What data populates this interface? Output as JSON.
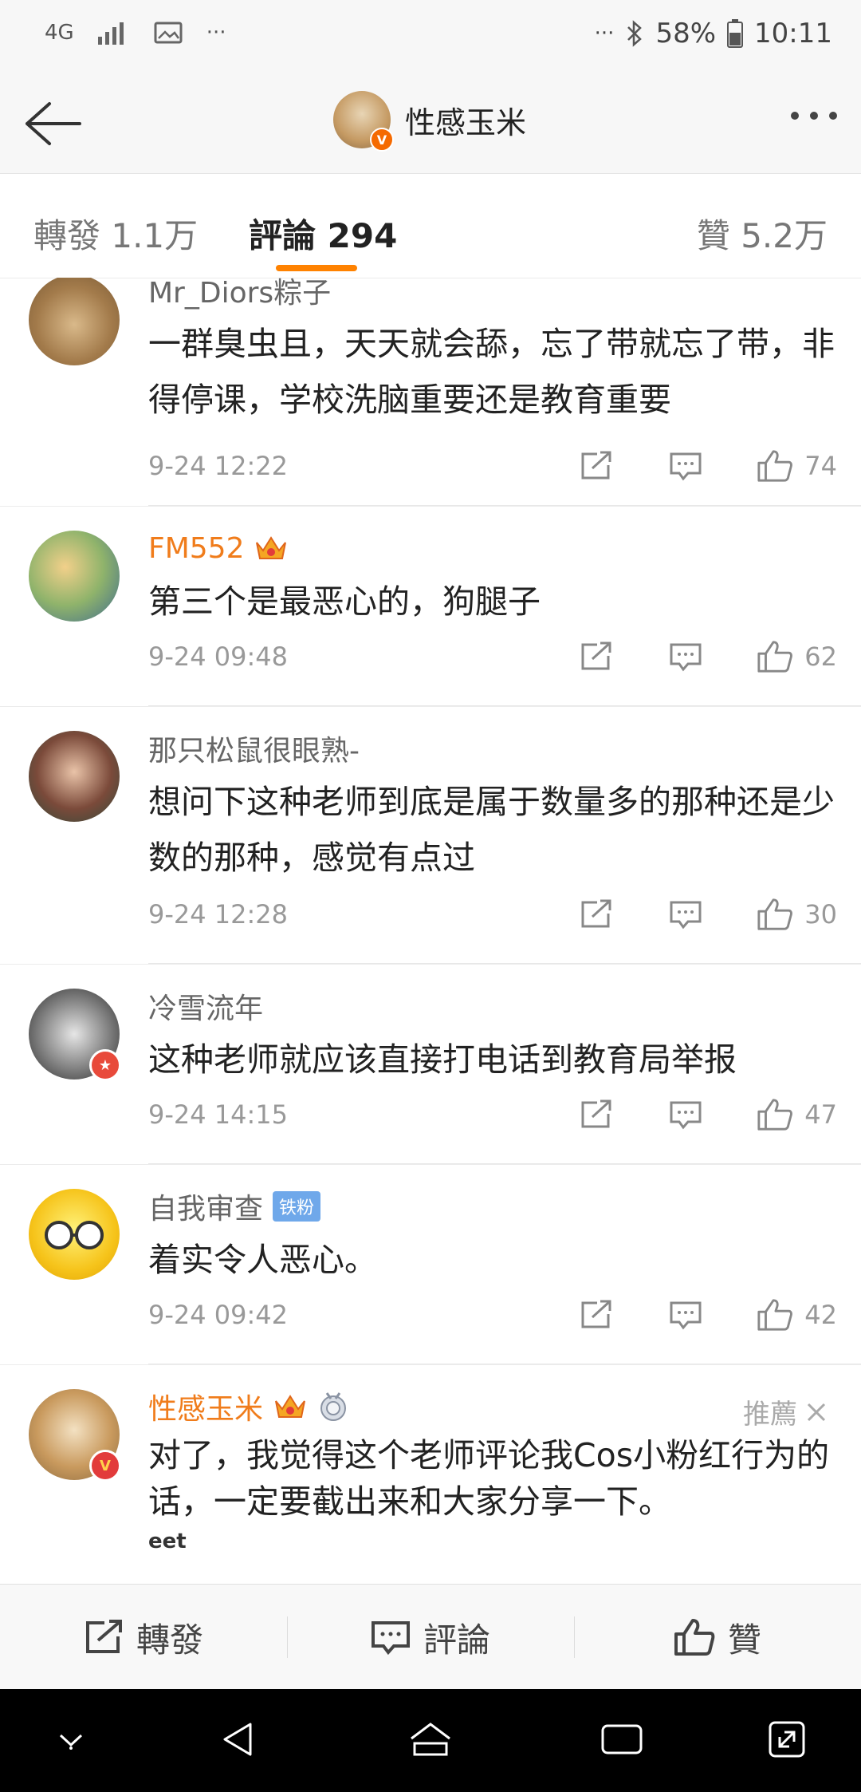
{
  "status_bar": {
    "network": "4G",
    "signal": "signal-icon",
    "gallery": "image-icon",
    "dots": "···",
    "dots_right": "···",
    "battery": "58%",
    "time": "10:11"
  },
  "header": {
    "title": "性感玉米",
    "verified_badge": "V"
  },
  "tabs": {
    "repost": "轉發 1.1万",
    "comments": "評論 294",
    "likes": "贊 5.2万"
  },
  "comments": [
    {
      "user": "Mr_Diors粽子",
      "text": "一群臭虫且，天天就会舔，忘了带就忘了带，非得停课，学校洗脑重要还是教育重要",
      "time": "9-24 12:22",
      "likes": "74"
    },
    {
      "user": "FM552",
      "text": "第三个是最恶心的，狗腿子",
      "time": "9-24 09:48",
      "likes": "62"
    },
    {
      "user": "那只松鼠很眼熟-",
      "text": "想问下这种老师到底是属于数量多的那种还是少数的那种，感觉有点过",
      "time": "9-24 12:28",
      "likes": "30"
    },
    {
      "user": "冷雪流年",
      "text": "这种老师就应该直接打电话到教育局举报",
      "time": "9-24 14:15",
      "likes": "47"
    },
    {
      "user": "自我审查",
      "tag": "铁粉",
      "text": "着实令人恶心。",
      "time": "9-24 09:42",
      "likes": "42"
    },
    {
      "user": "性感玉米",
      "recommend": "推薦",
      "text": "对了，我觉得这个老师评论我Cos小粉红行为的话，一定要截出来和大家分享一下。",
      "partial": "eet"
    }
  ],
  "bottom_bar": {
    "repost": "轉發",
    "comment": "評論",
    "like": "贊"
  },
  "colors": {
    "accent": "#ff8200",
    "username_orange": "#f07c1b",
    "tag_blue": "#6fa8ea"
  }
}
